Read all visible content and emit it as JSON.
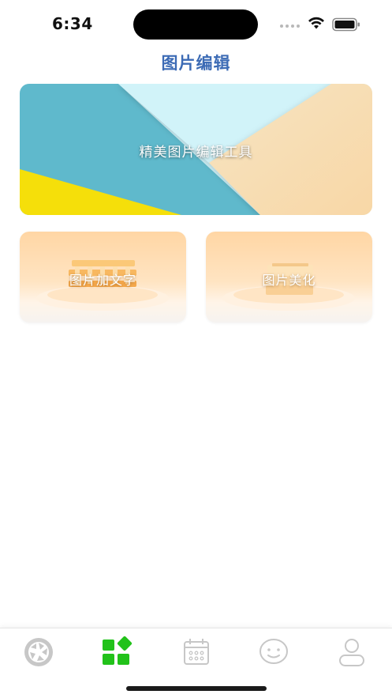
{
  "status_bar": {
    "time": "6:34"
  },
  "header": {
    "title": "图片编辑"
  },
  "hero": {
    "label": "精美图片编辑工具"
  },
  "features": [
    {
      "label": "图片加文字"
    },
    {
      "label": "图片美化"
    }
  ],
  "tabbar": {
    "items": [
      {
        "icon": "aperture-icon",
        "active": false
      },
      {
        "icon": "grid-apps-icon",
        "active": true
      },
      {
        "icon": "calendar-icon",
        "active": false
      },
      {
        "icon": "smiley-icon",
        "active": false
      },
      {
        "icon": "profile-icon",
        "active": false
      }
    ]
  },
  "colors": {
    "title": "#3c6bb5",
    "tab_active": "#22c21a",
    "tab_inactive": "#c7c7c7",
    "hero_teal": "#5fb9cc",
    "hero_cyan": "#cdf1f8",
    "hero_peach": "#f7dcb0",
    "hero_yellow": "#f5df0a"
  }
}
